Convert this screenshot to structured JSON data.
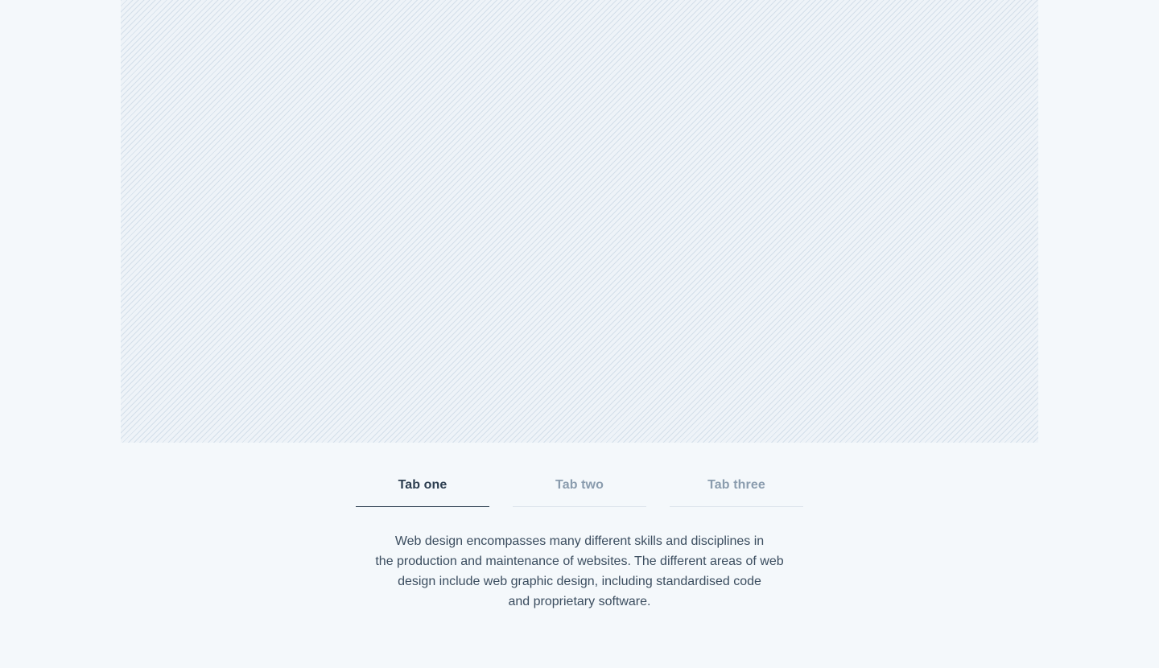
{
  "tabs": [
    {
      "label": "Tab one",
      "active": true
    },
    {
      "label": "Tab two",
      "active": false
    },
    {
      "label": "Tab three",
      "active": false
    }
  ],
  "content": {
    "lines": [
      "Web design encompasses many different skills and disciplines in",
      "the production and maintenance of websites. The different areas of web",
      "design include web graphic design, including standardised code",
      "and proprietary software."
    ]
  },
  "colors": {
    "background": "#f4f8fb",
    "active_tab": "#2c3e50",
    "inactive_tab": "#8a9cae",
    "body_text": "#3b4d5f"
  }
}
